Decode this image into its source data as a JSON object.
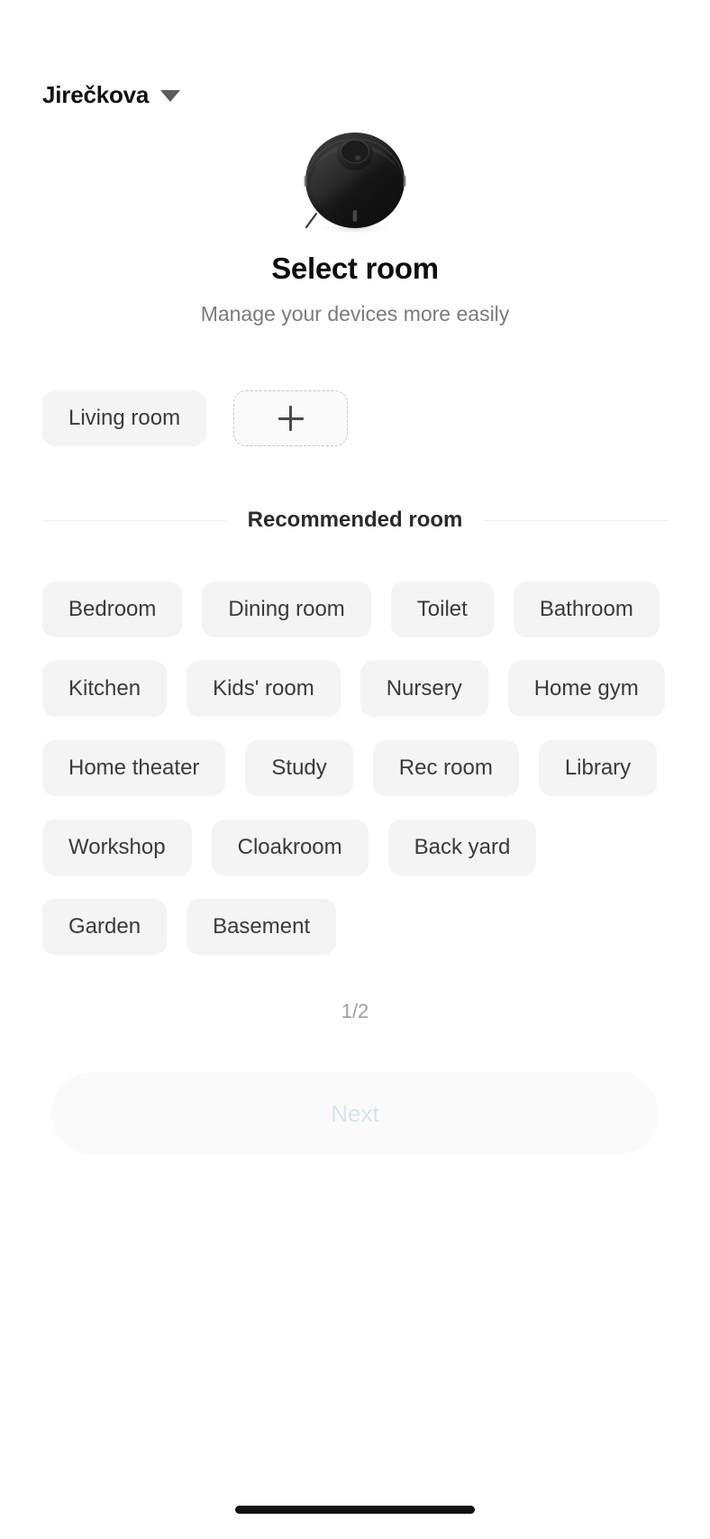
{
  "header": {
    "home_name": "Jirečkova",
    "dropdown_icon": "chevron-down-icon"
  },
  "device": {
    "icon": "robot-vacuum-image",
    "body_color": "#1d1d1d",
    "turret_color": "#2c2c2c"
  },
  "main": {
    "title": "Select room",
    "subtitle": "Manage your devices more easily"
  },
  "selected_rooms": {
    "chips": [
      "Living room"
    ],
    "add_button": {
      "icon": "plus-icon",
      "label": ""
    }
  },
  "recommended": {
    "section_label": "Recommended room",
    "rooms": [
      "Bedroom",
      "Dining room",
      "Toilet",
      "Bathroom",
      "Kitchen",
      "Kids' room",
      "Nursery",
      "Home gym",
      "Home theater",
      "Study",
      "Rec room",
      "Library",
      "Workshop",
      "Cloakroom",
      "Back yard",
      "Garden",
      "Basement"
    ]
  },
  "pagination": {
    "label": "1/2",
    "current": 1,
    "total": 2
  },
  "footer": {
    "next_label": "Next",
    "next_disabled": true,
    "next_text_color": "#d5e7ee"
  },
  "colors": {
    "background": "#ffffff",
    "chip_bg": "#f4f4f4",
    "chip_text": "#3a3a3a",
    "subtitle_text": "#7b7b7b",
    "divider": "#ececec",
    "pager_text": "#a0a0a0"
  }
}
